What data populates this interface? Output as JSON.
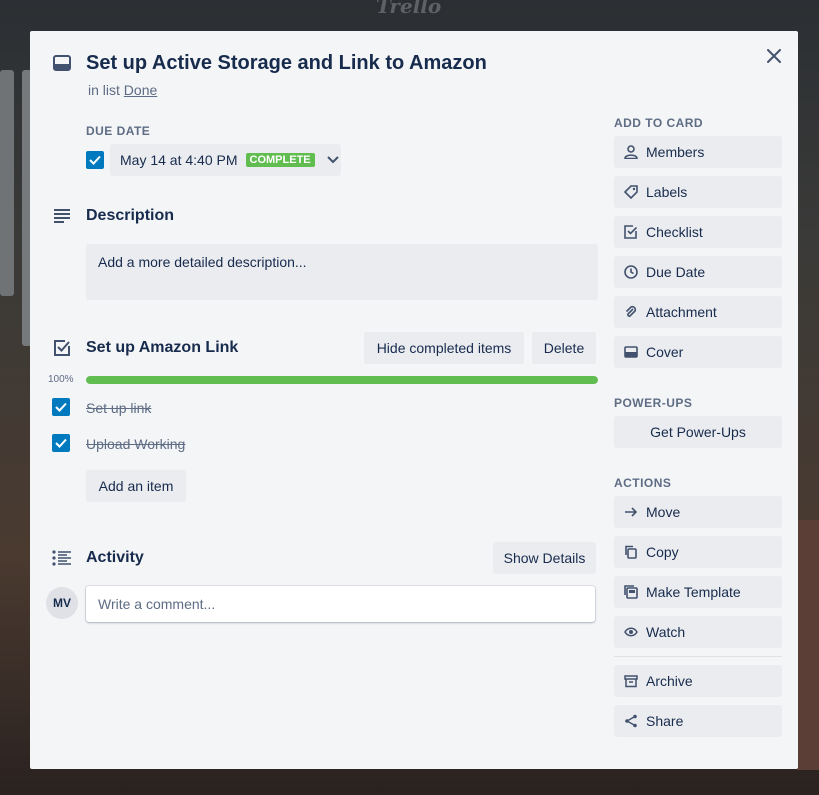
{
  "background": {
    "logo": "Trello"
  },
  "card": {
    "title": "Set up Active Storage and Link to Amazon",
    "in_list_prefix": "in list",
    "list_name": "Done"
  },
  "due": {
    "label": "DUE DATE",
    "date": "May 14 at 4:40 PM",
    "status": "COMPLETE",
    "checked": true
  },
  "description": {
    "heading": "Description",
    "placeholder": "Add a more detailed description..."
  },
  "checklist": {
    "title": "Set up Amazon Link",
    "hide_completed_label": "Hide completed items",
    "delete_label": "Delete",
    "progress_label": "100%",
    "progress": 1.0,
    "items": [
      {
        "text": "Set up link",
        "checked": true
      },
      {
        "text": "Upload Working",
        "checked": true
      }
    ],
    "add_item_label": "Add an item"
  },
  "activity": {
    "heading": "Activity",
    "show_details_label": "Show Details",
    "avatar_initials": "MV",
    "comment_placeholder": "Write a comment..."
  },
  "sidebar": {
    "add_to_card_label": "ADD TO CARD",
    "add_to_card": [
      {
        "label": "Members",
        "icon": "person-icon"
      },
      {
        "label": "Labels",
        "icon": "tag-icon"
      },
      {
        "label": "Checklist",
        "icon": "checklist-icon"
      },
      {
        "label": "Due Date",
        "icon": "clock-icon"
      },
      {
        "label": "Attachment",
        "icon": "paperclip-icon"
      },
      {
        "label": "Cover",
        "icon": "cover-icon"
      }
    ],
    "powerups_label": "POWER-UPS",
    "get_powerups_label": "Get Power-Ups",
    "actions_label": "ACTIONS",
    "actions": [
      {
        "label": "Move",
        "icon": "arrow-right-icon"
      },
      {
        "label": "Copy",
        "icon": "copy-icon"
      },
      {
        "label": "Make Template",
        "icon": "template-icon"
      },
      {
        "label": "Watch",
        "icon": "eye-icon"
      },
      {
        "label": "Archive",
        "icon": "archive-icon"
      },
      {
        "label": "Share",
        "icon": "share-icon"
      }
    ]
  },
  "colors": {
    "accent": "#0079bf",
    "success": "#61bd4f",
    "modal_bg": "#f4f5f7",
    "button_bg": "#ebecf0",
    "text": "#172b4d",
    "subtle_text": "#5e6c84"
  }
}
